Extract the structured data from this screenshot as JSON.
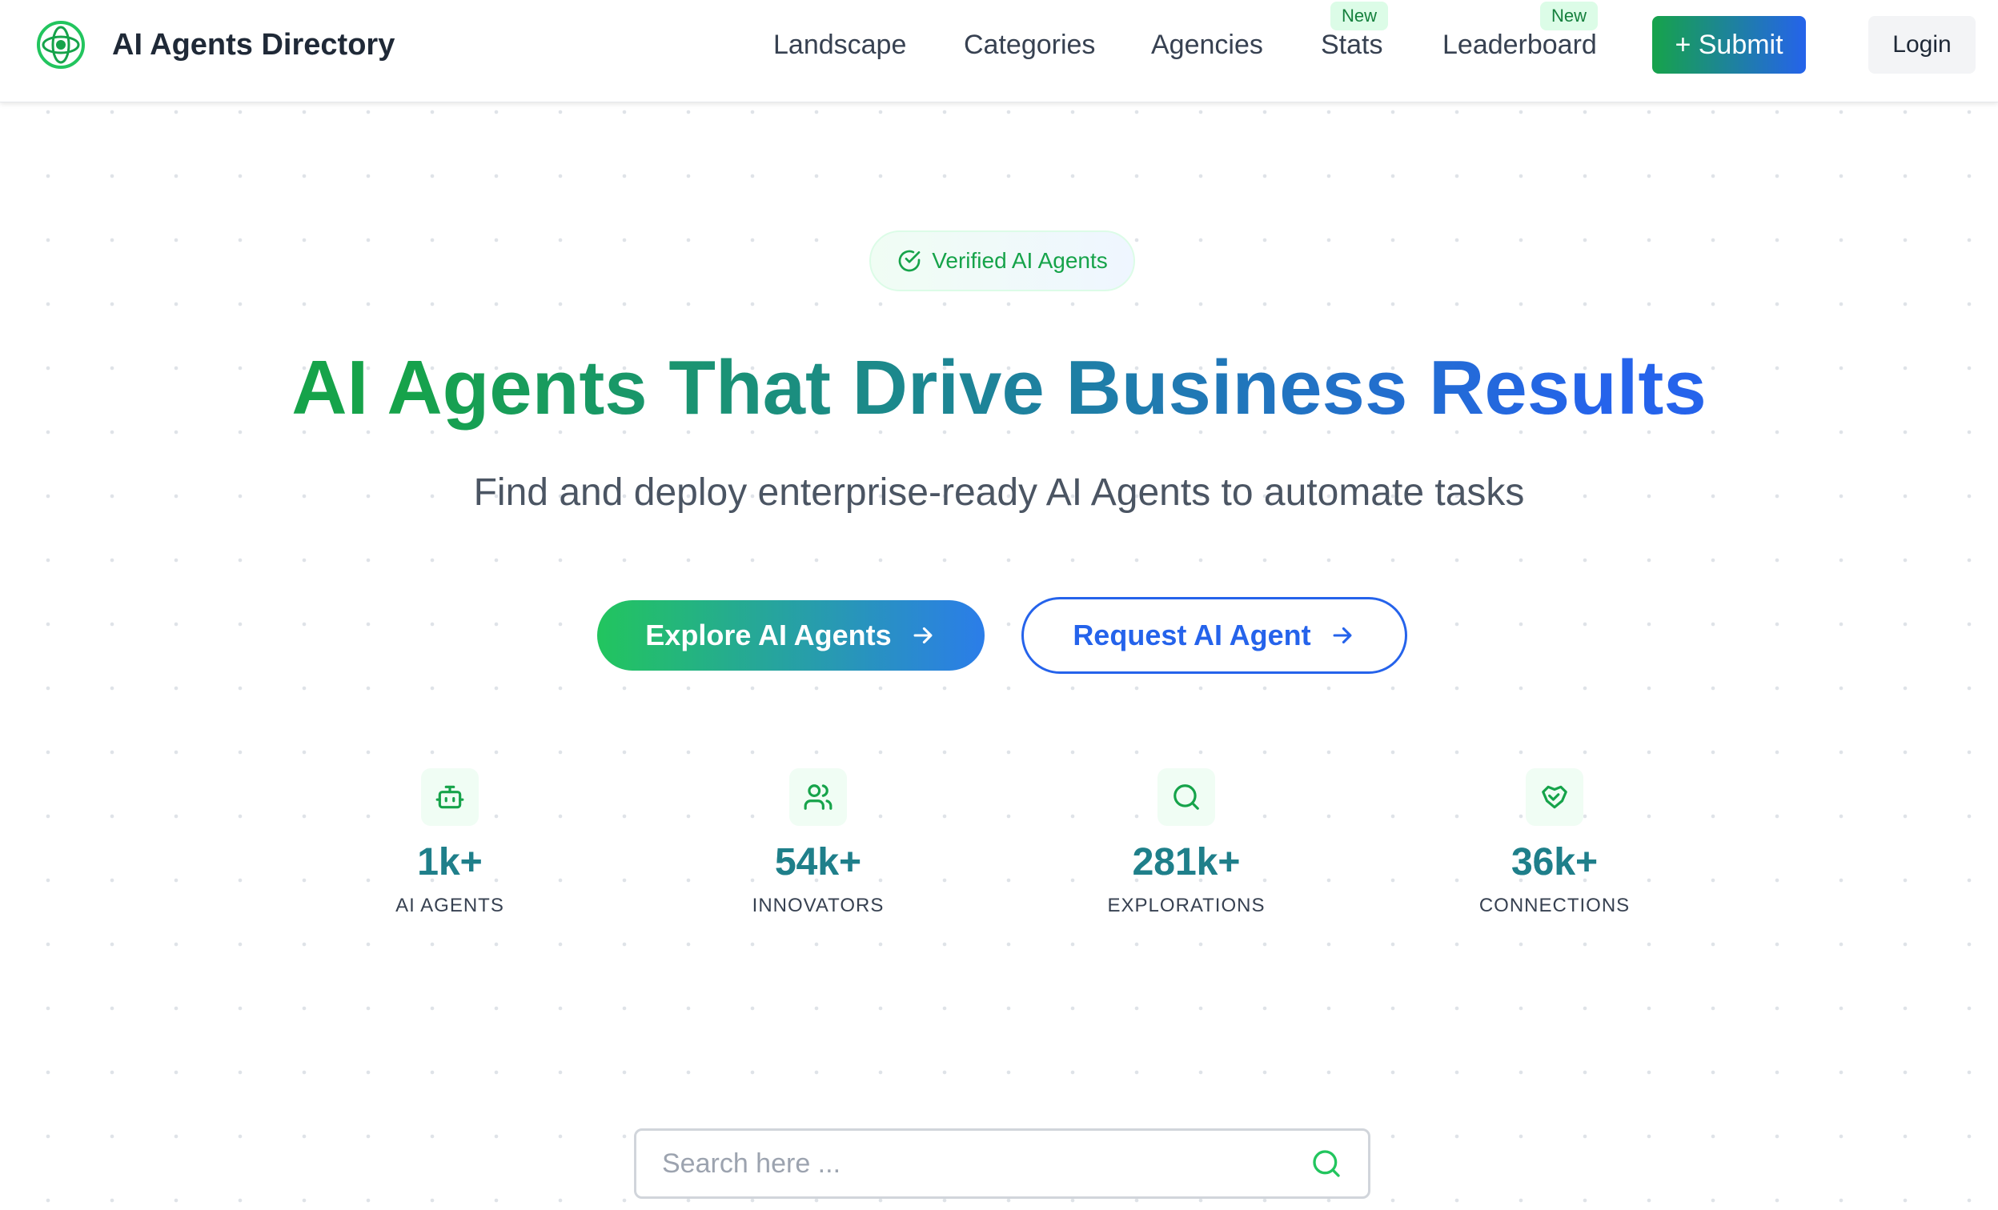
{
  "brand": {
    "name": "AI Agents Directory",
    "logo_icon": "orbit-logo-icon"
  },
  "nav": {
    "items": [
      {
        "label": "Landscape"
      },
      {
        "label": "Categories"
      },
      {
        "label": "Agencies"
      },
      {
        "label": "Stats",
        "badge": "New"
      },
      {
        "label": "Leaderboard",
        "badge": "New"
      }
    ],
    "submit_label": "+ Submit",
    "login_label": "Login"
  },
  "hero": {
    "pill_text": "Verified AI Agents",
    "title": "AI Agents That Drive Business Results",
    "subtitle": "Find and deploy enterprise-ready AI Agents to automate tasks",
    "primary_cta": "Explore AI Agents",
    "secondary_cta": "Request AI Agent"
  },
  "stats": [
    {
      "icon": "robot-icon",
      "value": "1k+",
      "label": "AI AGENTS"
    },
    {
      "icon": "users-icon",
      "value": "54k+",
      "label": "INNOVATORS"
    },
    {
      "icon": "search-icon",
      "value": "281k+",
      "label": "EXPLORATIONS"
    },
    {
      "icon": "handshake-icon",
      "value": "36k+",
      "label": "CONNECTIONS"
    }
  ],
  "search": {
    "placeholder": "Search here ...",
    "value": ""
  },
  "colors": {
    "brand_green": "#16a34a",
    "brand_blue": "#2563eb",
    "badge_bg": "#dcfce7"
  }
}
